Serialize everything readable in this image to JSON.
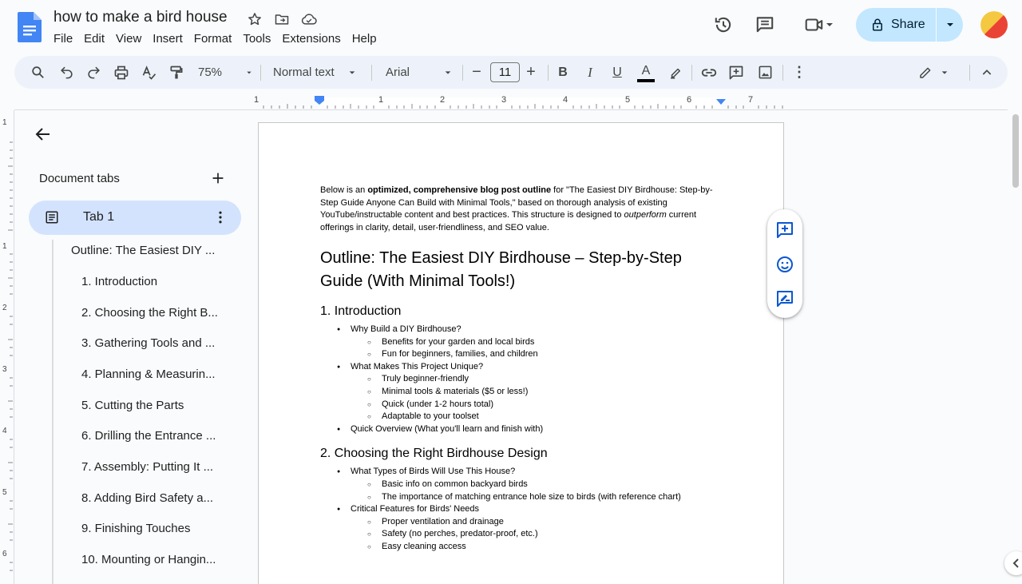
{
  "header": {
    "title": "how to make a bird house",
    "menu": [
      "File",
      "Edit",
      "View",
      "Insert",
      "Format",
      "Tools",
      "Extensions",
      "Help"
    ],
    "share_label": "Share",
    "icons": [
      "docs-logo-icon",
      "star-icon",
      "move-folder-icon",
      "cloud-saved-icon",
      "version-history-icon",
      "comments-icon",
      "meet-video-icon",
      "lock-icon",
      "avatar"
    ]
  },
  "toolbar": {
    "zoom": "75%",
    "style": "Normal text",
    "font": "Arial",
    "font_size": "11",
    "minus": "−",
    "plus": "+",
    "bold": "B",
    "italic": "I",
    "underline": "U",
    "text_color_letter": "A",
    "kebab": "⋮"
  },
  "ruler": {
    "h_labels": [
      "1",
      "1",
      "2",
      "3",
      "4",
      "5",
      "6",
      "7"
    ],
    "v_labels": [
      "1",
      "1",
      "2",
      "3",
      "4",
      "5",
      "6"
    ]
  },
  "sidebar": {
    "heading": "Document tabs",
    "tab_label": "Tab 1",
    "outline": [
      "Outline: The Easiest DIY ...",
      "1. Introduction",
      "2. Choosing the Right B...",
      "3. Gathering Tools and ...",
      "4. Planning & Measurin...",
      "5. Cutting the Parts",
      "6. Drilling the Entrance ...",
      "7. Assembly: Putting It ...",
      "8. Adding Bird Safety a...",
      "9. Finishing Touches",
      "10. Mounting or Hangin..."
    ]
  },
  "document": {
    "intro": {
      "p1": "Below is an ",
      "b1": "optimized, comprehensive blog post outline",
      "p2": " for \"The Easiest DIY Birdhouse: Step-by-Step Guide Anyone Can Build with Minimal Tools,\" based on thorough analysis of existing YouTube/instructable content and best practices. This structure is designed to ",
      "i1": "outperform",
      "p3": " current offerings in clarity, detail, user-friendliness, and SEO value."
    },
    "h1": "Outline: The Easiest DIY Birdhouse – Step-by-Step Guide (With Minimal Tools!)",
    "sections": [
      {
        "heading": "1. Introduction",
        "items": [
          {
            "level": 1,
            "text": "Why Build a DIY Birdhouse?"
          },
          {
            "level": 2,
            "text": "Benefits for your garden and local birds"
          },
          {
            "level": 2,
            "text": "Fun for beginners, families, and children"
          },
          {
            "level": 1,
            "text": "What Makes This Project Unique?"
          },
          {
            "level": 2,
            "text": "Truly beginner-friendly"
          },
          {
            "level": 2,
            "text": "Minimal tools & materials ($5 or less!)"
          },
          {
            "level": 2,
            "text": "Quick (under 1-2 hours total)"
          },
          {
            "level": 2,
            "text": "Adaptable to your toolset"
          },
          {
            "level": 1,
            "text": "Quick Overview (What you'll learn and finish with)"
          }
        ]
      },
      {
        "heading": "2. Choosing the Right Birdhouse Design",
        "items": [
          {
            "level": 1,
            "text": "What Types of Birds Will Use This House?"
          },
          {
            "level": 2,
            "text": "Basic info on common backyard birds"
          },
          {
            "level": 2,
            "text": "The importance of matching entrance hole size to birds (with reference chart)"
          },
          {
            "level": 1,
            "text": "Critical Features for Birds' Needs"
          },
          {
            "level": 2,
            "text": "Proper ventilation and drainage"
          },
          {
            "level": 2,
            "text": "Safety (no perches, predator-proof, etc.)"
          },
          {
            "level": 2,
            "text": "Easy cleaning access"
          }
        ]
      }
    ]
  },
  "colors": {
    "docs_blue": "#4285f4",
    "share_bg": "#c2e7ff",
    "toolbar_bg": "#edf2fa",
    "tab_selected": "#d3e3fd",
    "accent_blue": "#0b57d0"
  }
}
